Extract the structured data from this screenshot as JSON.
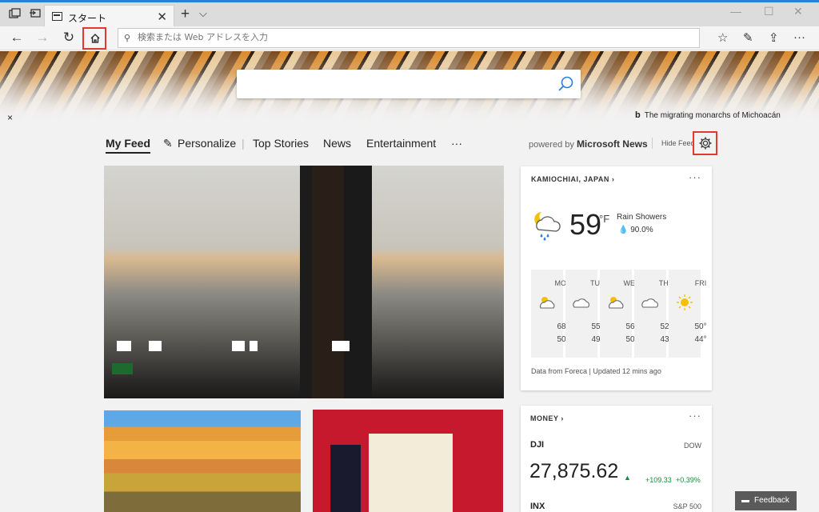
{
  "browser": {
    "tab_title": "スタート",
    "tab_close": "✕",
    "new_tab": "+",
    "tabs_menu": "⌵",
    "address_placeholder": "検索または Web アドレスを入力",
    "win_min": "—",
    "win_max": "☐",
    "win_close": "✕"
  },
  "hero": {
    "search_placeholder": "",
    "credit": "The migrating monarchs of Michoacán",
    "dismiss": "×"
  },
  "feed_nav": {
    "items": [
      "My Feed",
      "Personalize",
      "Top Stories",
      "News",
      "Entertainment"
    ],
    "more": "···",
    "powered_prefix": "powered by",
    "powered_brand": "Microsoft News",
    "hide_feed": "Hide Feed"
  },
  "weather": {
    "location": "KAMIOCHIAI, JAPAN",
    "temp": "59",
    "unit": "°F",
    "condition": "Rain Showers",
    "precip": "90.0%",
    "days": [
      {
        "name": "MON",
        "hi": "68°",
        "lo": "50°",
        "icon": "partly-sunny"
      },
      {
        "name": "TUE",
        "hi": "55°",
        "lo": "49°",
        "icon": "cloudy"
      },
      {
        "name": "WED",
        "hi": "56°",
        "lo": "50°",
        "icon": "partly-sunny"
      },
      {
        "name": "THU",
        "hi": "52°",
        "lo": "43°",
        "icon": "cloudy"
      },
      {
        "name": "FRI",
        "hi": "50°",
        "lo": "44°",
        "icon": "sunny"
      }
    ],
    "footer": "Data from Foreca | Updated 12 mins ago"
  },
  "money": {
    "title": "MONEY",
    "rows": [
      {
        "symbol": "DJI",
        "exchange": "DOW",
        "value": "27,875.62",
        "change": "+109.33",
        "percent": "+0.39%"
      },
      {
        "symbol": "INX",
        "exchange": "S&P 500"
      }
    ]
  },
  "feedback": "Feedback",
  "colors": {
    "accent": "#2b7fd9",
    "highlight": "#e03a2f",
    "positive": "#1a8a3a"
  }
}
